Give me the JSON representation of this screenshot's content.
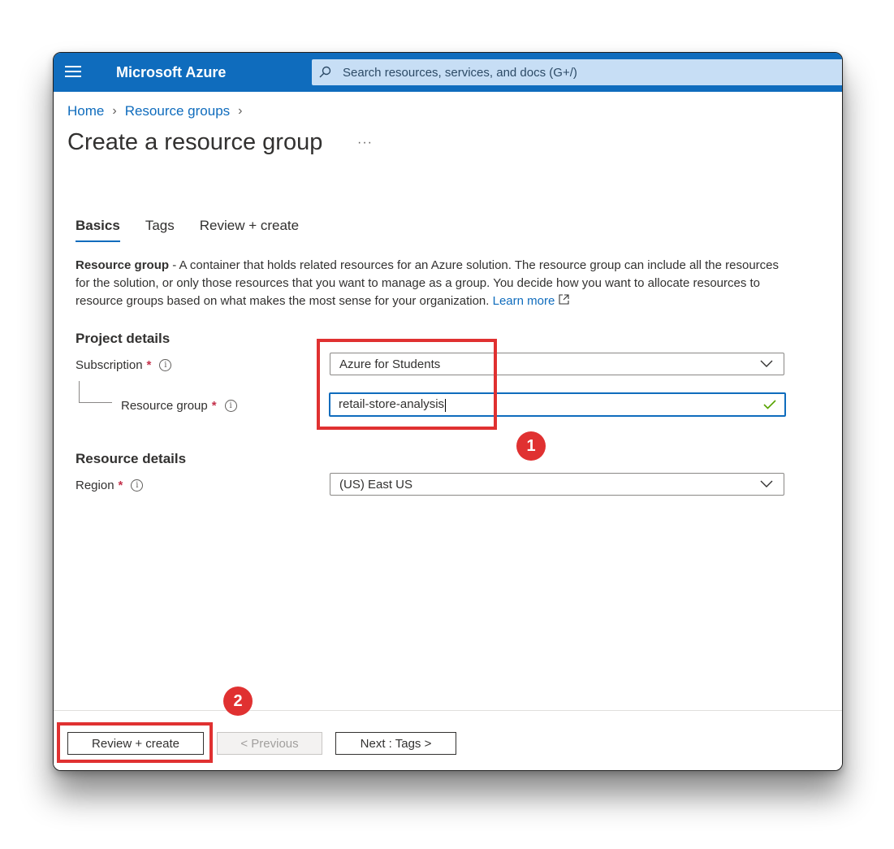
{
  "app": {
    "brand": "Microsoft Azure"
  },
  "search": {
    "placeholder": "Search resources, services, and docs (G+/)"
  },
  "breadcrumb": {
    "items": [
      "Home",
      "Resource groups"
    ]
  },
  "page": {
    "title": "Create a resource group",
    "more": "···"
  },
  "tabs": [
    {
      "label": "Basics",
      "active": true
    },
    {
      "label": "Tags",
      "active": false
    },
    {
      "label": "Review + create",
      "active": false
    }
  ],
  "description": {
    "term": "Resource group",
    "text": " - A container that holds related resources for an Azure solution. The resource group can include all the resources for the solution, or only those resources that you want to manage as a group. You decide how you want to allocate resources to resource groups based on what makes the most sense for your organization. ",
    "link": "Learn more"
  },
  "project_details": {
    "heading": "Project details",
    "subscription": {
      "label": "Subscription",
      "required": "*",
      "value": "Azure for Students"
    },
    "resource_group": {
      "label": "Resource group",
      "required": "*",
      "value": "retail-store-analysis"
    }
  },
  "resource_details": {
    "heading": "Resource details",
    "region": {
      "label": "Region",
      "required": "*",
      "value": "(US) East US"
    }
  },
  "footer": {
    "review_create": "Review + create",
    "previous": "< Previous",
    "next": "Next : Tags >"
  },
  "annotations": {
    "marker1": "1",
    "marker2": "2",
    "color": "#e03131"
  },
  "colors": {
    "topbar": "#0f6cbd",
    "accent": "#0f6cbd",
    "search_bg": "#c7def5",
    "required": "#c4314b",
    "valid": "#57a300"
  }
}
